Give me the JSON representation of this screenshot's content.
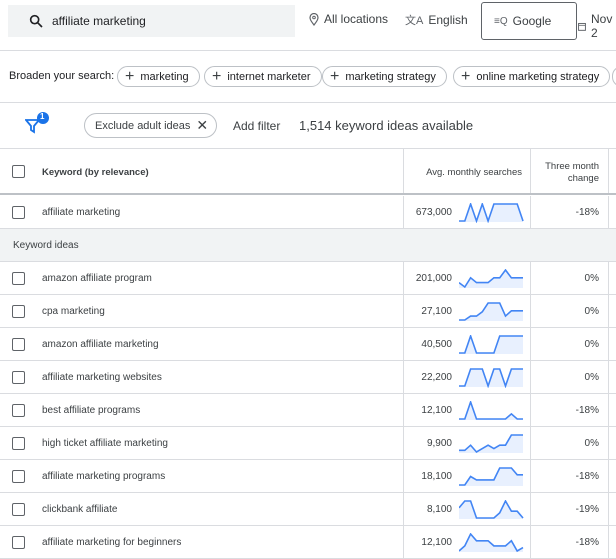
{
  "topbar": {
    "search_value": "affiliate marketing",
    "location": "All locations",
    "language": "English",
    "network": "Google",
    "date": "Nov 2"
  },
  "broaden": {
    "label": "Broaden your search:",
    "chips": [
      "marketing",
      "internet marketer",
      "marketing strategy",
      "online marketing strategy"
    ]
  },
  "filters": {
    "badge": "1",
    "chip": "Exclude adult ideas",
    "add_filter": "Add filter",
    "count_text": "1,514 keyword ideas available"
  },
  "table": {
    "headers": {
      "keyword": "Keyword (by relevance)",
      "searches": "Avg. monthly searches",
      "change": "Three month change"
    },
    "group_label": "Keyword ideas",
    "accent": "#4285f4",
    "searched": {
      "keyword": "affiliate marketing",
      "searches": "673,000",
      "change": "-18%",
      "trend": [
        0,
        0,
        1,
        0,
        1,
        0,
        1,
        1,
        1,
        1,
        1,
        0
      ]
    },
    "rows": [
      {
        "keyword": "amazon affiliate program",
        "searches": "201,000",
        "change": "0%",
        "trend": [
          0.26,
          0,
          0.54,
          0.26,
          0.26,
          0.26,
          0.54,
          0.54,
          1,
          0.54,
          0.54,
          0.54
        ]
      },
      {
        "keyword": "cpa marketing",
        "searches": "27,100",
        "change": "0%",
        "trend": [
          0,
          0,
          0.23,
          0.23,
          0.48,
          1,
          1,
          1,
          0.23,
          0.54,
          0.54,
          0.54
        ]
      },
      {
        "keyword": "amazon affiliate marketing",
        "searches": "40,500",
        "change": "0%",
        "trend": [
          0,
          0,
          1,
          0,
          0,
          0,
          0,
          1,
          1,
          1,
          1,
          1
        ]
      },
      {
        "keyword": "affiliate marketing websites",
        "searches": "22,200",
        "change": "0%",
        "trend": [
          0,
          0,
          1,
          1,
          1,
          0,
          1,
          1,
          0,
          1,
          1,
          1
        ]
      },
      {
        "keyword": "best affiliate programs",
        "searches": "12,100",
        "change": "-18%",
        "trend": [
          0,
          0,
          1,
          0,
          0,
          0,
          0,
          0,
          0,
          0.3,
          0,
          0
        ]
      },
      {
        "keyword": "high ticket affiliate marketing",
        "searches": "9,900",
        "change": "0%",
        "trend": [
          0.1,
          0.1,
          0.4,
          0,
          0.2,
          0.4,
          0.2,
          0.4,
          0.4,
          1,
          1,
          1
        ]
      },
      {
        "keyword": "affiliate marketing programs",
        "searches": "18,100",
        "change": "-18%",
        "trend": [
          0,
          0,
          0.5,
          0.3,
          0.3,
          0.3,
          0.3,
          1,
          1,
          1,
          0.6,
          0.6
        ]
      },
      {
        "keyword": "clickbank affiliate",
        "searches": "8,100",
        "change": "-19%",
        "trend": [
          0.6,
          1,
          1,
          0,
          0,
          0,
          0,
          0.3,
          1,
          0.4,
          0.4,
          0
        ]
      },
      {
        "keyword": "affiliate marketing for beginners",
        "searches": "12,100",
        "change": "-18%",
        "trend": [
          0,
          0.3,
          1,
          0.6,
          0.6,
          0.6,
          0.3,
          0.3,
          0.3,
          0.6,
          0,
          0.2
        ]
      }
    ]
  }
}
